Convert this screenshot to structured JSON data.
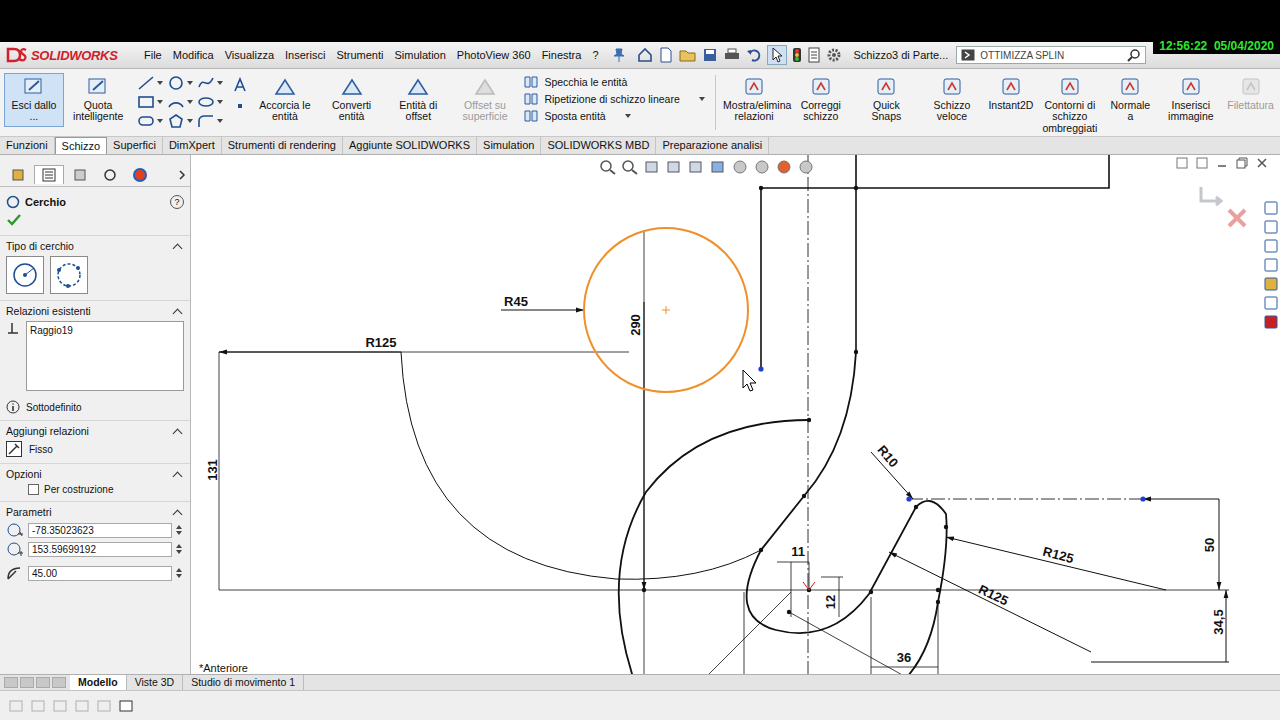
{
  "app": {
    "logo": "SOLIDWORKS",
    "title": "Schizzo3 di Parte...",
    "clock": "12:56:22  05/04/2020"
  },
  "menu": [
    "File",
    "Modifica",
    "Visualizza",
    "Inserisci",
    "Strumenti",
    "Simulation",
    "PhotoView 360",
    "Finestra",
    "?"
  ],
  "search": {
    "value": "OTTIMIZZA SPLIN"
  },
  "ribbon": {
    "primary": [
      {
        "label": "Esci dallo ...",
        "selected": true
      },
      {
        "label": "Quota intelligente",
        "selected": false
      }
    ],
    "edit": [
      {
        "label": "Accorcia le entità",
        "disabled": false
      },
      {
        "label": "Converti entità",
        "disabled": false
      },
      {
        "label": "Entità di offset",
        "disabled": false
      },
      {
        "label": "Offset su superficie",
        "disabled": true
      }
    ],
    "stack": [
      "Specchia le entità",
      "Ripetizione di schizzo lineare",
      "Sposta entità"
    ],
    "tools": [
      {
        "label": "Mostra/elimina relazioni",
        "disabled": false
      },
      {
        "label": "Correggi schizzo",
        "disabled": false
      },
      {
        "label": "Quick Snaps",
        "disabled": false
      },
      {
        "label": "Schizzo veloce",
        "disabled": false
      },
      {
        "label": "Instant2D",
        "disabled": false
      },
      {
        "label": "Contorni di schizzo ombreggiati",
        "disabled": false
      },
      {
        "label": "Normale a",
        "disabled": false
      },
      {
        "label": "Inserisci immagine",
        "disabled": false
      },
      {
        "label": "Filettatura",
        "disabled": true
      }
    ]
  },
  "command_tabs": [
    {
      "label": "Funzioni",
      "selected": false
    },
    {
      "label": "Schizzo",
      "selected": true
    },
    {
      "label": "Superfici",
      "selected": false
    },
    {
      "label": "DimXpert",
      "selected": false
    },
    {
      "label": "Strumenti di rendering",
      "selected": false
    },
    {
      "label": "Aggiunte SOLIDWORKS",
      "selected": false
    },
    {
      "label": "Simulation",
      "selected": false
    },
    {
      "label": "SOLIDWORKS MBD",
      "selected": false
    },
    {
      "label": "Preparazione analisi",
      "selected": false
    }
  ],
  "property_manager": {
    "title": "Cerchio",
    "help": "?",
    "circle_type": {
      "heading": "Tipo di cerchio",
      "expanded": true,
      "options": [
        {
          "kind": "center"
        },
        {
          "kind": "perimeter"
        }
      ]
    },
    "existing_relations": {
      "heading": "Relazioni esistenti",
      "expanded": true,
      "items": [
        "Raggio19"
      ],
      "status": "Sottodefinito"
    },
    "add_relations": {
      "heading": "Aggiungi relazioni",
      "expanded": true,
      "items": [
        "Fisso"
      ]
    },
    "options": {
      "heading": "Opzioni",
      "expanded": true,
      "checkboxes": [
        {
          "label": "Per costruzione",
          "checked": false
        }
      ]
    },
    "parameters": {
      "heading": "Parametri",
      "expanded": true,
      "fields": [
        {
          "kind": "x",
          "value": "-78.35023623"
        },
        {
          "kind": "y",
          "value": "153.59699192"
        },
        {
          "kind": "radius",
          "value": "45.00"
        }
      ]
    }
  },
  "sketch": {
    "circle": {
      "selected": true
    },
    "dimensions": [
      "R45",
      "290",
      "R125",
      "131",
      "R10",
      "50",
      "R125",
      "R125",
      "11",
      "12",
      "36",
      "34,5"
    ]
  },
  "view_label": "*Anteriore",
  "bottom_tabs": [
    {
      "label": "Modello",
      "selected": true
    },
    {
      "label": "Viste 3D",
      "selected": false
    },
    {
      "label": "Studio di movimento 1",
      "selected": false
    }
  ]
}
